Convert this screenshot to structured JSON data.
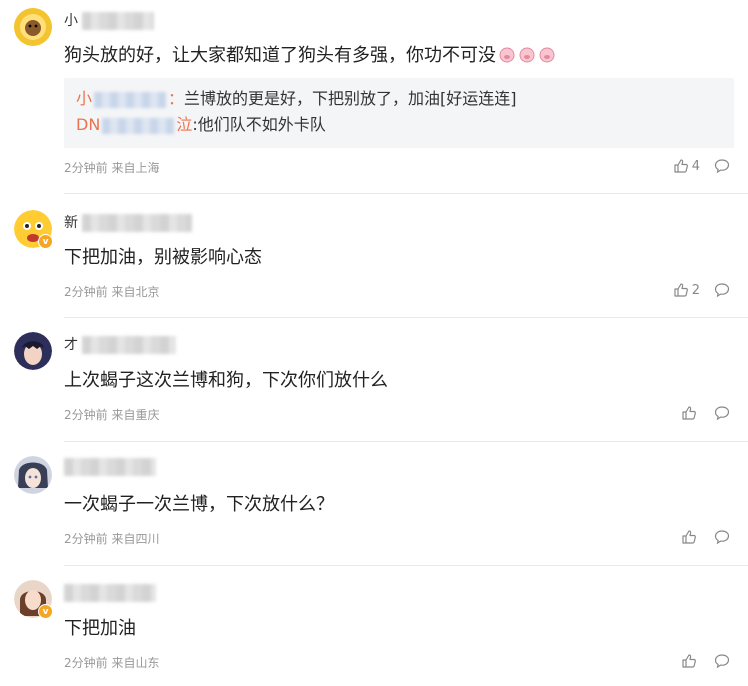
{
  "comments": [
    {
      "name_first": "小",
      "text": "狗头放的好，让大家都知道了狗头有多强，你功不可没",
      "emoji_name": "pig-emoji",
      "replies": [
        {
          "name_start": "小",
          "name_end": "：",
          "text": "兰博放的更是好，下把别放了，加油[好运连连]"
        },
        {
          "name_start": "DN",
          "name_end": "泣",
          "text": ":他们队不如外卡队"
        }
      ],
      "time": "2分钟前",
      "source": "来自上海",
      "likes": "4",
      "avatar_icon": "sunflower-avatar"
    },
    {
      "name_first": "新",
      "text": "下把加油，别被影响心态",
      "time": "2分钟前",
      "source": "来自北京",
      "likes": "2",
      "avatar_icon": "emoji-face-avatar",
      "verified": true
    },
    {
      "name_first": "才",
      "text": "上次蝎子这次兰博和狗，下次你们放什么",
      "time": "2分钟前",
      "source": "来自重庆",
      "likes": "",
      "avatar_icon": "anime-boy-avatar"
    },
    {
      "name_first": "",
      "text": "一次蝎子一次兰博，下次放什么？",
      "time": "2分钟前",
      "source": "来自四川",
      "likes": "",
      "avatar_icon": "anime-girl-avatar"
    },
    {
      "name_first": "",
      "text": "下把加油",
      "time": "2分钟前",
      "source": "来自山东",
      "likes": "",
      "avatar_icon": "photo-avatar",
      "verified": true
    }
  ],
  "colors": {
    "link": "#eb7350",
    "meta": "#999999",
    "quote_bg": "#f4f5f7",
    "verified": "#f5a623"
  },
  "icons": {
    "like": "thumbs-up-icon",
    "comment": "comment-bubble-icon",
    "verified": "verified-badge-icon"
  }
}
